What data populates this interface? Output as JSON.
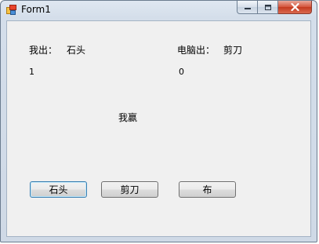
{
  "window": {
    "title": "Form1",
    "icons": {
      "app": "form-app-icon",
      "minimize": "minimize-icon",
      "maximize": "maximize-icon",
      "close": "close-icon"
    },
    "colors": {
      "close_button": "#c43a1f",
      "client_background": "#f0f0f0"
    }
  },
  "form": {
    "player_label": "我出：",
    "player_choice": "石头",
    "computer_label": "电脑出：",
    "computer_choice": "剪刀",
    "player_score": "1",
    "computer_score": "0",
    "result": "我赢"
  },
  "buttons": {
    "rock": "石头",
    "scissors": "剪刀",
    "paper": "布"
  }
}
